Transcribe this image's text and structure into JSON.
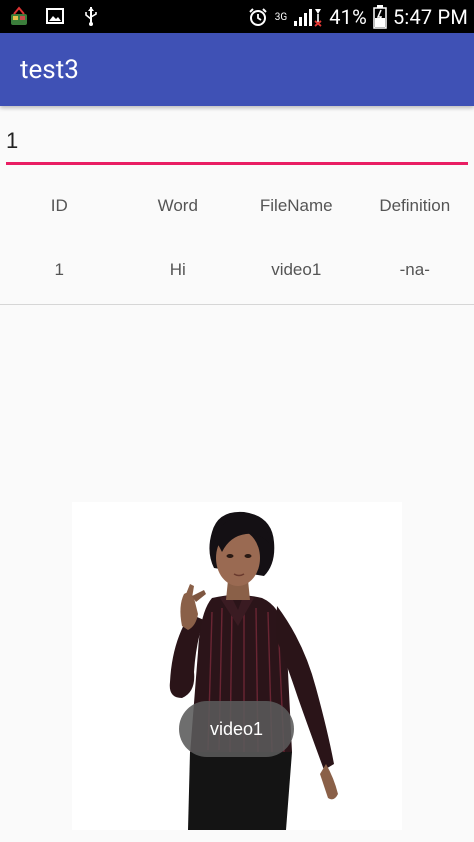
{
  "status_bar": {
    "icons_left": [
      "app-notification-icon",
      "image-icon",
      "usb-icon"
    ],
    "icons_right": [
      "alarm-icon",
      "network-3g-icon",
      "signal-icon",
      "battery-icon"
    ],
    "network": "3G",
    "battery": "41%",
    "time": "5:47",
    "ampm": "PM"
  },
  "app_bar": {
    "title": "test3",
    "color": "#3f51b5"
  },
  "search": {
    "value": "1",
    "underline_color": "#e91e63"
  },
  "table": {
    "headers": [
      "ID",
      "Word",
      "FileName",
      "Definition"
    ],
    "rows": [
      [
        "1",
        "Hi",
        "video1",
        "-na-"
      ]
    ]
  },
  "video": {
    "toast": "video1"
  }
}
